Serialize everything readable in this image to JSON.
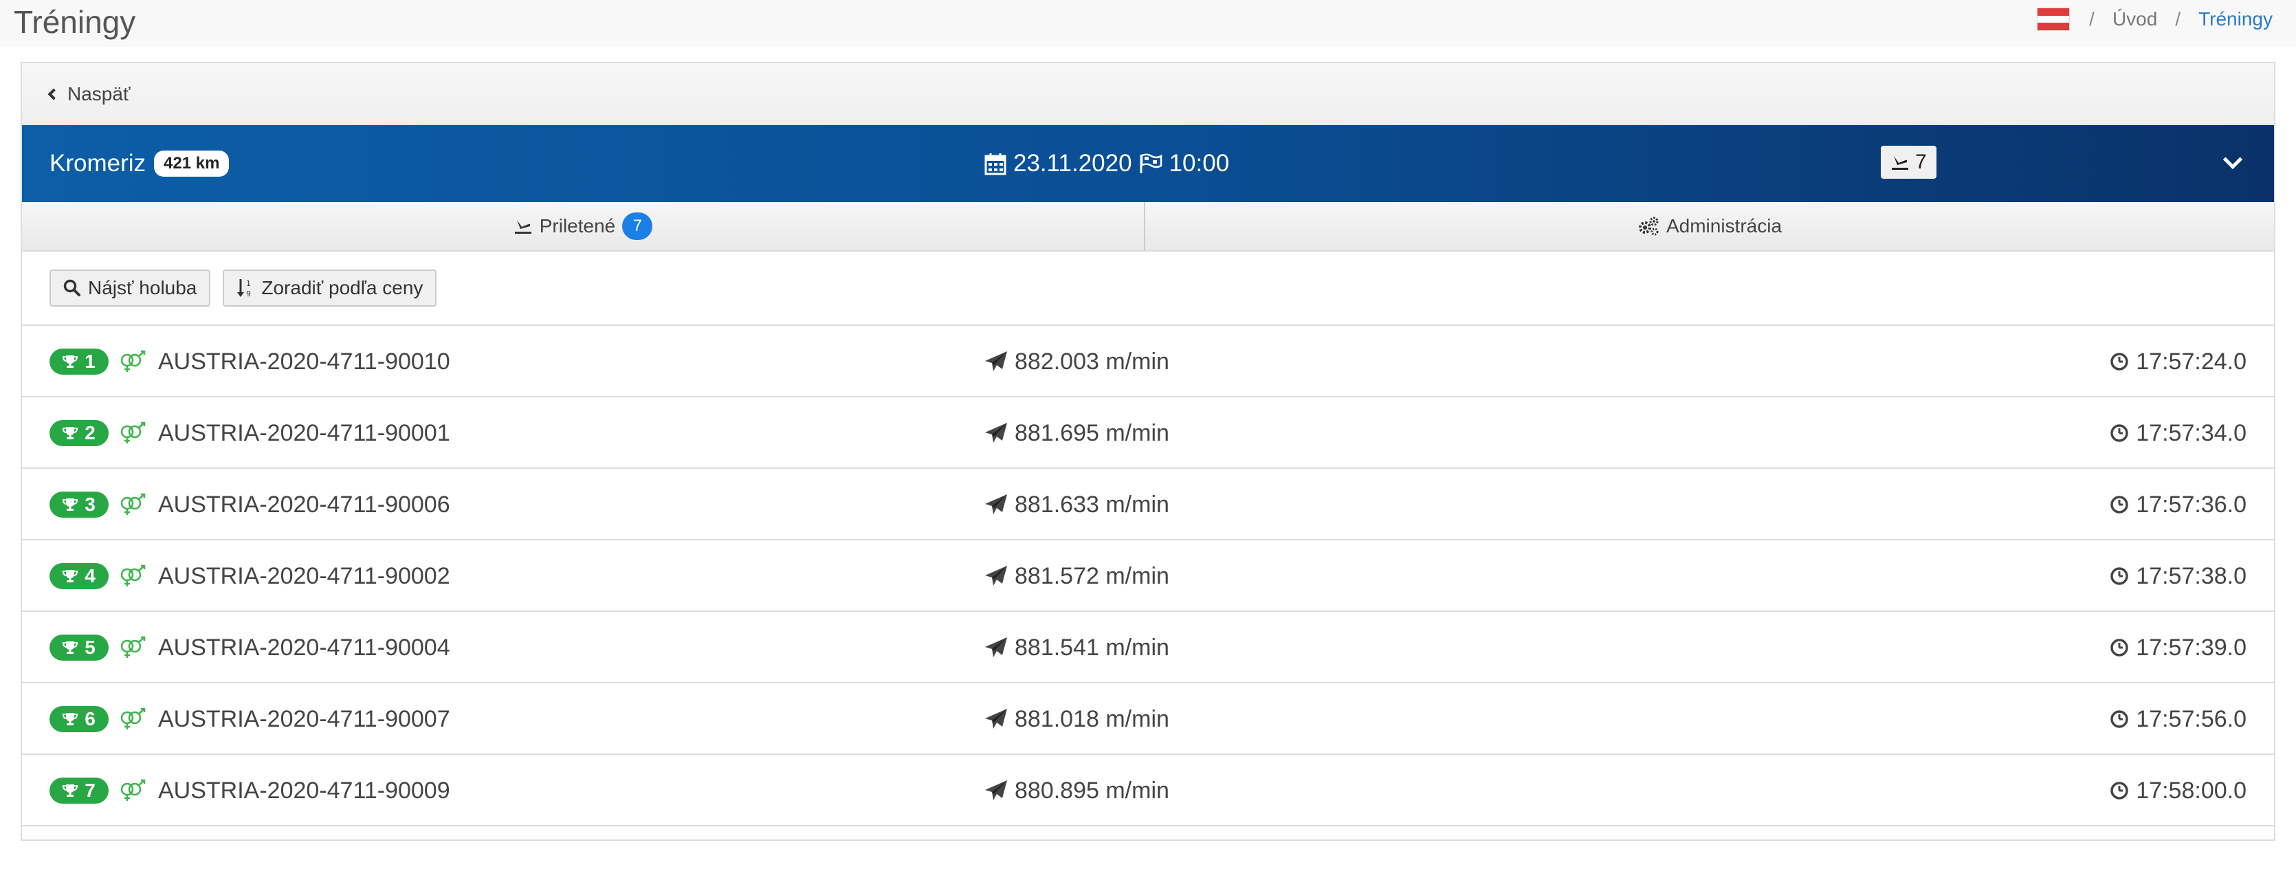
{
  "header": {
    "title": "Tréningy",
    "breadcrumb": {
      "home": "Úvod",
      "current": "Tréningy",
      "separator": "/"
    }
  },
  "panel": {
    "back_label": "Naspäť",
    "race": {
      "name": "Kromeriz",
      "distance": "421 km",
      "date": "23.11.2020",
      "time": "10:00",
      "arrived_count": "7"
    },
    "tabs": [
      {
        "label": "Priletené",
        "badge": "7"
      },
      {
        "label": "Administrácia"
      }
    ],
    "toolbar": {
      "find_label": "Nájsť holuba",
      "sort_label": "Zoradiť podľa ceny"
    },
    "rows": [
      {
        "rank": "1",
        "ring": "AUSTRIA-2020-4711-90010",
        "speed": "882.003 m/min",
        "time": "17:57:24.0"
      },
      {
        "rank": "2",
        "ring": "AUSTRIA-2020-4711-90001",
        "speed": "881.695 m/min",
        "time": "17:57:34.0"
      },
      {
        "rank": "3",
        "ring": "AUSTRIA-2020-4711-90006",
        "speed": "881.633 m/min",
        "time": "17:57:36.0"
      },
      {
        "rank": "4",
        "ring": "AUSTRIA-2020-4711-90002",
        "speed": "881.572 m/min",
        "time": "17:57:38.0"
      },
      {
        "rank": "5",
        "ring": "AUSTRIA-2020-4711-90004",
        "speed": "881.541 m/min",
        "time": "17:57:39.0"
      },
      {
        "rank": "6",
        "ring": "AUSTRIA-2020-4711-90007",
        "speed": "881.018 m/min",
        "time": "17:57:56.0"
      },
      {
        "rank": "7",
        "ring": "AUSTRIA-2020-4711-90009",
        "speed": "880.895 m/min",
        "time": "17:58:00.0"
      }
    ]
  },
  "colors": {
    "race_bar": "#0a4f95",
    "rank_badge": "#28a745",
    "gender_icon": "#3cb54a",
    "tab_badge": "#1a7fe6",
    "breadcrumb_active": "#2a7ac8"
  },
  "icons": {
    "flag": "austria-flag-icon",
    "back": "chevron-left-icon",
    "date": "calendar-icon",
    "start": "checkered-flag-icon",
    "arrival": "landing-icon",
    "collapse": "chevron-down-icon",
    "admin": "gears-icon",
    "find": "search-icon",
    "sort": "sort-icon",
    "rank": "trophy-icon",
    "gender": "gender-pair-icon",
    "speed": "paper-plane-icon",
    "time": "clock-icon"
  }
}
